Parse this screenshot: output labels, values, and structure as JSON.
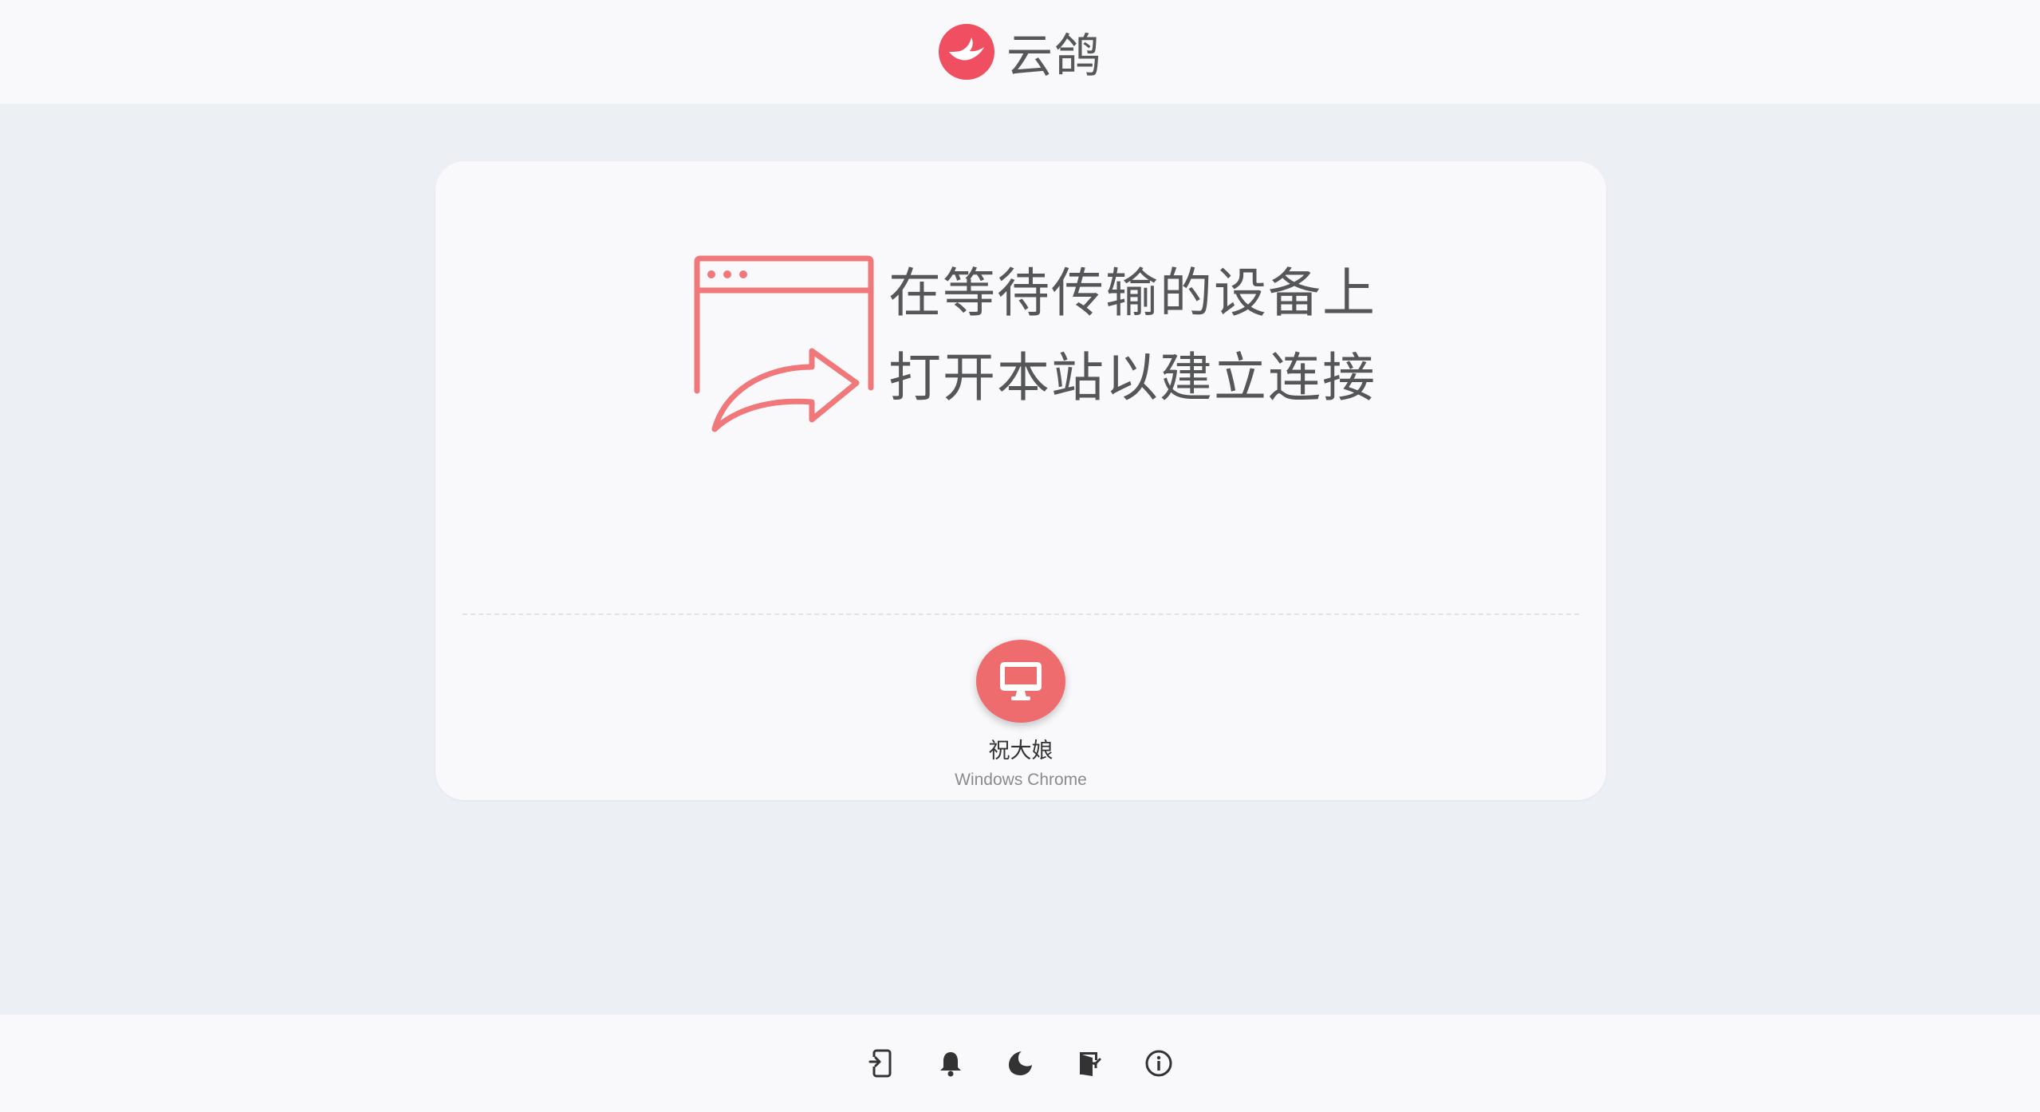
{
  "app": {
    "name": "云鸽",
    "logo_icon": "pigeon-logo-icon",
    "accent_color": "#ee6b6e"
  },
  "instructions": {
    "icon": "browser-share-icon",
    "line1": "在等待传输的设备上",
    "line2": "打开本站以建立连接"
  },
  "peers": [
    {
      "name": "祝大娘",
      "device": "Windows Chrome",
      "icon": "desktop-monitor-icon"
    }
  ],
  "footer": {
    "actions": [
      {
        "name": "pair-device-button",
        "icon": "pair-device-icon"
      },
      {
        "name": "notifications-button",
        "icon": "bell-icon"
      },
      {
        "name": "dark-mode-button",
        "icon": "moon-icon"
      },
      {
        "name": "leave-button",
        "icon": "exit-door-icon"
      },
      {
        "name": "about-button",
        "icon": "info-icon"
      }
    ]
  }
}
